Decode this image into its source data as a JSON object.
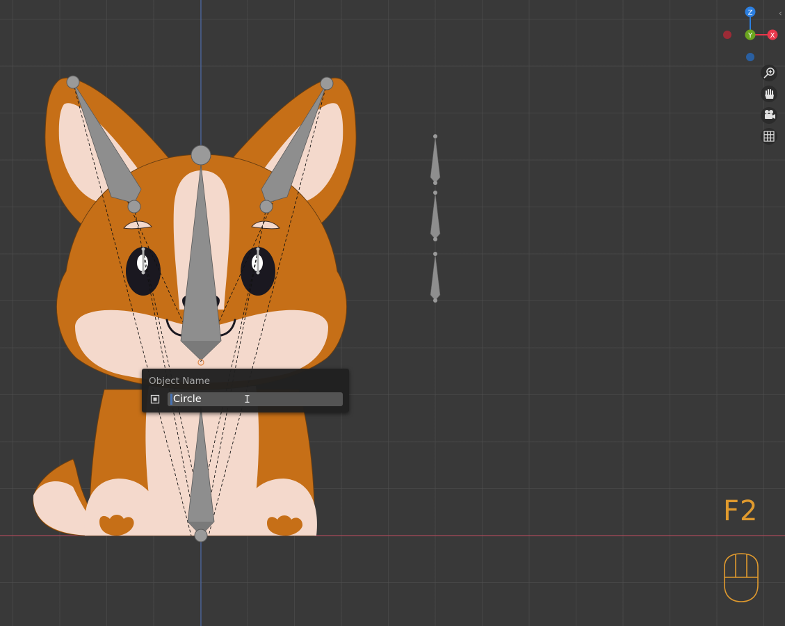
{
  "popup": {
    "title": "Object Name",
    "field_value": "Circle",
    "icon": "object-data-icon"
  },
  "gizmo": {
    "z_label": "Z",
    "y_label": "Y",
    "x_label": "X",
    "colors": {
      "x": "#e8374b",
      "y": "#6ba51f",
      "z": "#2c7fe0",
      "x_neg": "#9c2b36",
      "z_neg": "#2a5fa0"
    }
  },
  "nav_buttons": [
    "zoom-icon",
    "pan-hand-icon",
    "camera-icon",
    "ortho-grid-icon"
  ],
  "key_overlay": {
    "label": "F2",
    "color": "#e09a2e"
  },
  "colors": {
    "background": "#393939",
    "grid": "#505050",
    "fur_orange": "#c66f17",
    "fur_cream": "#f4d9cc",
    "bone": "#8e8e8e",
    "x_axis_line": "#a84a5a",
    "y_axis_line": "#4a68a8",
    "popup_bg": "#202020"
  }
}
